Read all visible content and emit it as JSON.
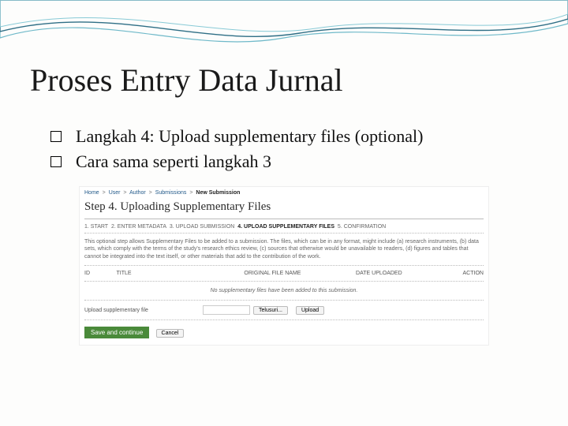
{
  "slide": {
    "title": "Proses Entry Data Jurnal",
    "bullets": [
      "Langkah 4: Upload supplementary files (optional)",
      "Cara sama seperti langkah 3"
    ]
  },
  "screenshot": {
    "breadcrumb": {
      "items": [
        "Home",
        "User",
        "Author",
        "Submissions"
      ],
      "current": "New Submission",
      "sep": ">"
    },
    "heading": "Step 4. Uploading Supplementary Files",
    "steps": {
      "s1": "1. START",
      "s2": "2. ENTER METADATA",
      "s3": "3. UPLOAD SUBMISSION",
      "s4": "4. UPLOAD SUPPLEMENTARY FILES",
      "s5": "5. CONFIRMATION"
    },
    "description": "This optional step allows Supplementary Files to be added to a submission. The files, which can be in any format, might include (a) research instruments, (b) data sets, which comply with the terms of the study's research ethics review, (c) sources that otherwise would be unavailable to readers, (d) figures and tables that cannot be integrated into the text itself, or other materials that add to the contribution of the work.",
    "table": {
      "headers": {
        "id": "ID",
        "title": "TITLE",
        "name": "ORIGINAL FILE NAME",
        "date": "DATE UPLOADED",
        "action": "ACTION"
      },
      "empty": "No supplementary files have been added to this submission."
    },
    "upload": {
      "label": "Upload supplementary file",
      "browse": "Telusuri...",
      "upload": "Upload"
    },
    "actions": {
      "save": "Save and continue",
      "cancel": "Cancel"
    }
  }
}
